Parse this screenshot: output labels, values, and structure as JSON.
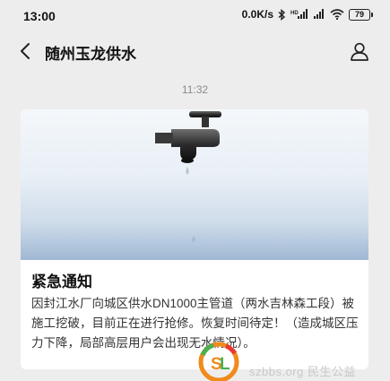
{
  "status_bar": {
    "time": "13:00",
    "network_speed": "0.0K/s",
    "battery_level": "79",
    "icons": [
      "bluetooth-icon",
      "signal-hd-icon",
      "signal-icon",
      "wifi-icon",
      "battery-icon"
    ]
  },
  "nav": {
    "title": "随州玉龙供水",
    "back_icon": "back-arrow-icon",
    "profile_icon": "person-icon"
  },
  "message": {
    "time": "11:32",
    "card": {
      "title": "紧急通知",
      "body": "因封江水厂向城区供水DN1000主管道（两水吉林森工段）被施工挖破，目前正在进行抢修。恢复时间待定！（造成城区压力下降，局部高层用户会出现无水情况）。"
    }
  },
  "watermark": {
    "text": "szbbs.org 民生公益"
  },
  "colors": {
    "background": "#ededed",
    "card": "#ffffff",
    "watermark_orange": "#f08a1c",
    "watermark_green": "#4caf50",
    "watermark_red": "#e53935"
  }
}
